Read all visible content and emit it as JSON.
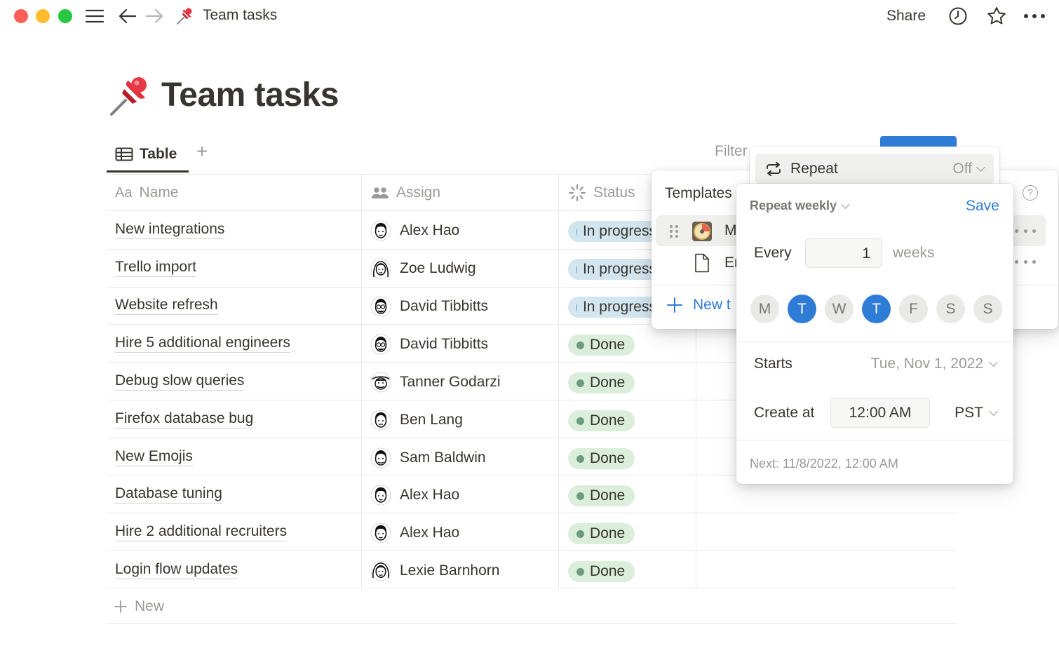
{
  "window": {
    "title": "Team tasks",
    "share_label": "Share"
  },
  "page": {
    "title": "Team tasks"
  },
  "views": {
    "active_tab": "Table",
    "filter_label": "Filter"
  },
  "table": {
    "columns": [
      {
        "label": "Name",
        "prefix": "Aa"
      },
      {
        "label": "Assign"
      },
      {
        "label": "Status"
      }
    ],
    "rows": [
      {
        "name": "New integrations",
        "assign": "Alex Hao",
        "status": "In progress"
      },
      {
        "name": "Trello import",
        "assign": "Zoe Ludwig",
        "status": "In progress"
      },
      {
        "name": "Website refresh",
        "assign": "David Tibbitts",
        "status": "In progress"
      },
      {
        "name": "Hire 5 additional engineers",
        "assign": "David Tibbitts",
        "status": "Done"
      },
      {
        "name": "Debug slow queries",
        "assign": "Tanner Godarzi",
        "status": "Done"
      },
      {
        "name": "Firefox database bug",
        "assign": "Ben Lang",
        "status": "Done"
      },
      {
        "name": "New Emojis",
        "assign": "Sam Baldwin",
        "status": "Done"
      },
      {
        "name": "Database tuning",
        "assign": "Alex Hao",
        "status": "Done"
      },
      {
        "name": "Hire 2 additional recruiters",
        "assign": "Alex Hao",
        "status": "Done"
      },
      {
        "name": "Login flow updates",
        "assign": "Lexie Barnhorn",
        "status": "Done"
      }
    ],
    "new_label": "New"
  },
  "templates": {
    "title": "Templates",
    "items": [
      {
        "label": "M"
      },
      {
        "label": "Er"
      }
    ],
    "new_label": "New t"
  },
  "repeat": {
    "label": "Repeat",
    "value": "Off",
    "mode": "Repeat weekly",
    "save_label": "Save",
    "every_label": "Every",
    "interval": "1",
    "unit": "weeks",
    "days": [
      {
        "letter": "M",
        "selected": false
      },
      {
        "letter": "T",
        "selected": true
      },
      {
        "letter": "W",
        "selected": false
      },
      {
        "letter": "T",
        "selected": true
      },
      {
        "letter": "F",
        "selected": false
      },
      {
        "letter": "S",
        "selected": false
      },
      {
        "letter": "S",
        "selected": false
      }
    ],
    "starts_label": "Starts",
    "starts_value": "Tue, Nov 1, 2022",
    "create_label": "Create at",
    "create_time": "12:00 AM",
    "timezone": "PST",
    "next_text": "Next: 11/8/2022, 12:00 AM"
  },
  "colors": {
    "accent": "#2f7cd6",
    "in_progress_bg": "#d3e5ef",
    "in_progress_dot": "#5b97bd",
    "done_bg": "#dbeddb",
    "done_dot": "#6c9b7d",
    "close": "#ff5f57",
    "minimize": "#febc2e",
    "zoom": "#28c840"
  }
}
